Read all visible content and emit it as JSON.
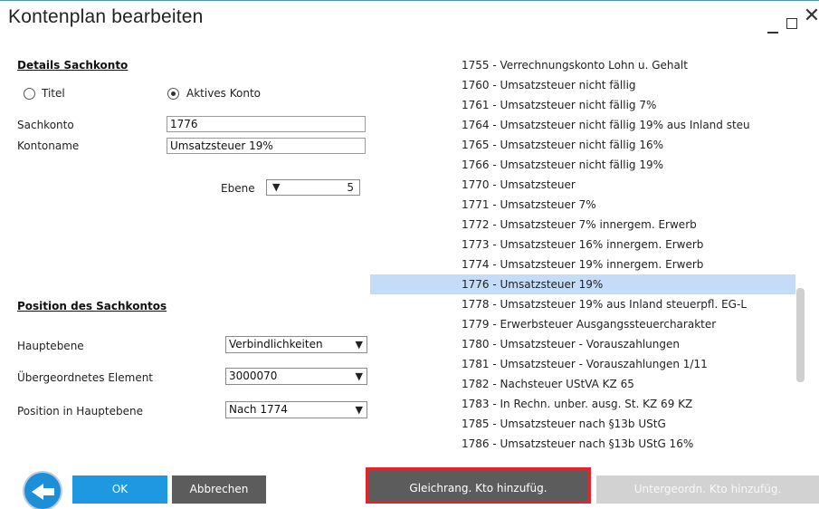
{
  "window": {
    "title": "Kontenplan bearbeiten"
  },
  "details": {
    "heading": "Details Sachkonto",
    "radio_titel": "Titel",
    "radio_aktiv": "Aktives Konto",
    "sachkonto_label": "Sachkonto",
    "sachkonto_value": "1776",
    "kontoname_label": "Kontoname",
    "kontoname_value": "Umsatzsteuer 19%",
    "ebene_label": "Ebene",
    "ebene_value": "5"
  },
  "position": {
    "heading": "Position des Sachkontos",
    "hauptebene_label": "Hauptebene",
    "hauptebene_value": "Verbindlichkeiten",
    "uebergeordnet_label": "Übergeordnetes Element",
    "uebergeordnet_value": "3000070",
    "pos_hauptebene_label": "Position in Hauptebene",
    "pos_hauptebene_value": "Nach 1774"
  },
  "accounts": [
    "1755 - Verrechnungskonto Lohn u. Gehalt",
    "1760 - Umsatzsteuer nicht fällig",
    "1761 - Umsatzsteuer nicht fällig 7%",
    "1764 - Umsatzsteuer nicht fällig 19% aus Inland steu",
    "1765 - Umsatzsteuer nicht fällig 16%",
    "1766 - Umsatzsteuer nicht fällig 19%",
    "1770 - Umsatzsteuer",
    "1771 - Umsatzsteuer 7%",
    "1772 - Umsatzsteuer 7% innergem. Erwerb",
    "1773 - Umsatzsteuer 16% innergem. Erwerb",
    "1774 - Umsatzsteuer 19% innergem. Erwerb",
    "1776 - Umsatzsteuer 19%",
    "1778 - Umsatzsteuer 19% aus Inland steuerpfl. EG-L",
    "1779 - Erwerbsteuer Ausgangssteuercharakter",
    "1780 - Umsatzsteuer - Vorauszahlungen",
    "1781 - Umsatzsteuer - Vorauszahlungen 1/11",
    "1782 - Nachsteuer UStVA KZ 65",
    "1783 - In Rechn. unber. ausg. St. KZ 69 KZ",
    "1785 - Umsatzsteuer nach §13b UStG",
    "1786 - Umsatzsteuer nach §13b UStG 16%"
  ],
  "selected_account": "1776 - Umsatzsteuer 19%",
  "buttons": {
    "ok": "OK",
    "cancel": "Abbrechen",
    "same_level": "Gleichrang. Kto hinzufüg.",
    "sub_level": "Untergeordn. Kto hinzufüg."
  },
  "colors": {
    "accent": "#1e98e0",
    "selection": "#c4dcf7",
    "highlight_border": "#e0262a"
  }
}
